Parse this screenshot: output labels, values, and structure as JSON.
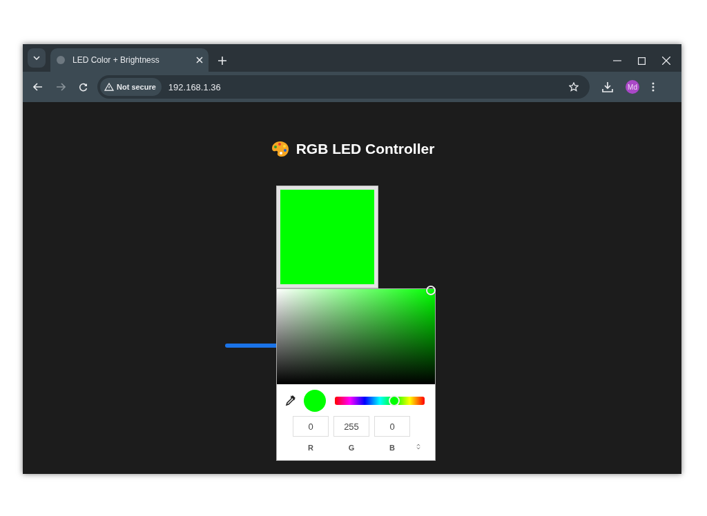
{
  "browser": {
    "tabs": [
      {
        "title": "LED Color + Brightness",
        "selected": true
      }
    ],
    "security_label": "Not secure",
    "url": "192.168.1.36",
    "profile_initials": "Md"
  },
  "page": {
    "title": "RGB LED Controller",
    "swatch": {
      "color": "#00ff00"
    }
  },
  "color_picker": {
    "preview": {
      "color": "#00ff00"
    },
    "hue": {
      "level": 0.66
    },
    "fields": [
      {
        "label": "R",
        "value": "0"
      },
      {
        "label": "G",
        "value": "255"
      },
      {
        "label": "B",
        "value": "0"
      }
    ]
  }
}
